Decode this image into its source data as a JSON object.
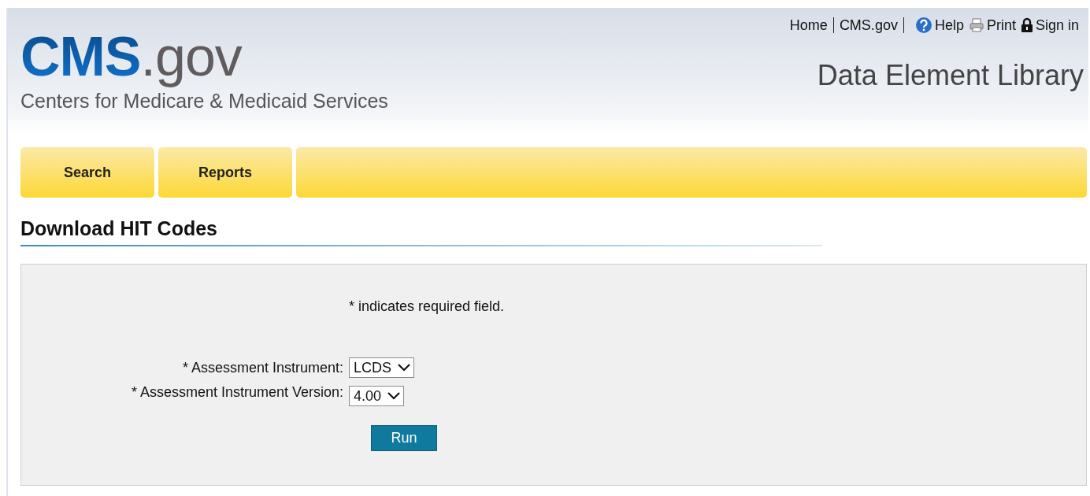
{
  "header": {
    "logo": {
      "brand": "CMS",
      "suffix": ".gov"
    },
    "tagline": "Centers for Medicare & Medicaid Services",
    "utility_links": [
      {
        "kind": "link",
        "label": "Home"
      },
      {
        "kind": "link",
        "label": "CMS.gov"
      },
      {
        "kind": "help",
        "label": "Help"
      },
      {
        "kind": "print",
        "label": "Print"
      },
      {
        "kind": "lock",
        "label": "Sign in"
      }
    ],
    "site_title": "Data Element Library"
  },
  "tabs": [
    {
      "label": "Search",
      "selected": false
    },
    {
      "label": "Reports",
      "selected": false
    }
  ],
  "page_title": "Download HIT Codes",
  "form": {
    "note": "* indicates required field.",
    "fields": [
      {
        "label": "* Assessment Instrument:",
        "value": "LCDS"
      },
      {
        "label": "* Assessment Instrument Version:",
        "value": "4.00"
      }
    ],
    "submit": "Run"
  }
}
